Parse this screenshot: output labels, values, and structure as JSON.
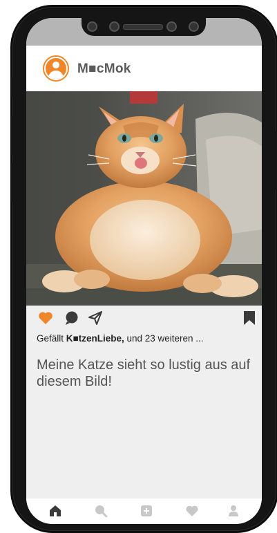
{
  "app": {
    "name": "M■cMok"
  },
  "post": {
    "likes_prefix": "Gefällt",
    "likes_user": "K■tzenLiebe,",
    "likes_suffix": "und 23 weiteren ...",
    "caption": "Meine Katze sieht so lustig aus auf diesem Bild!",
    "liked": true
  },
  "icons": {
    "like": "heart-icon",
    "comment": "speech-bubble-icon",
    "share": "paper-plane-icon",
    "save": "bookmark-icon"
  },
  "tabs": [
    {
      "name": "home",
      "icon": "home-icon",
      "active": true
    },
    {
      "name": "search",
      "icon": "search-icon",
      "active": false
    },
    {
      "name": "add",
      "icon": "plus-square-icon",
      "active": false
    },
    {
      "name": "favorites",
      "icon": "heart-icon",
      "active": false
    },
    {
      "name": "profile",
      "icon": "person-icon",
      "active": false
    }
  ],
  "colors": {
    "accent": "#f0862a",
    "icon_dark": "#3a3a3a",
    "icon_inactive": "#c8c8c8",
    "screen_bg": "#efefef"
  }
}
